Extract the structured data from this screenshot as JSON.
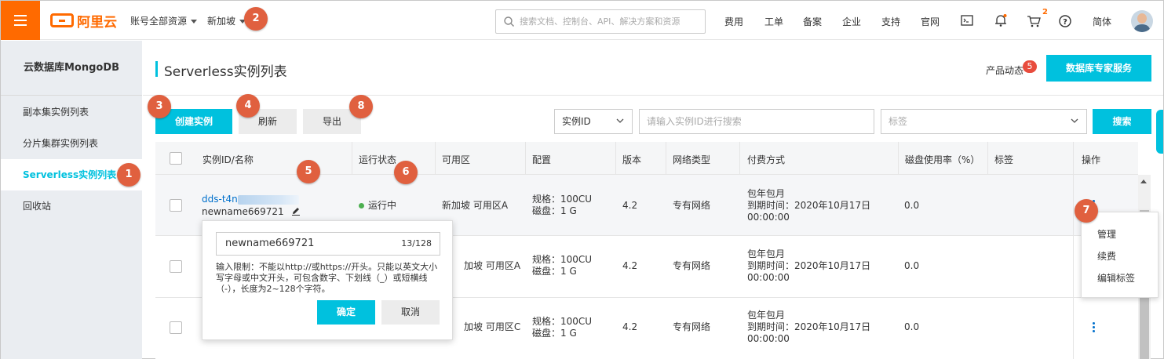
{
  "topbar": {
    "brand": "阿里云",
    "account_scope": "账号全部资源",
    "region": "新加坡",
    "search_placeholder": "搜索文档、控制台、API、解决方案和资源",
    "nav": [
      "费用",
      "工单",
      "备案",
      "企业",
      "支持",
      "官网"
    ],
    "cart_count": "2",
    "language": "简体"
  },
  "sidebar": {
    "title": "云数据库MongoDB",
    "items": [
      "副本集实例列表",
      "分片集群实例列表",
      "Serverless实例列表",
      "回收站"
    ],
    "active_index": 2
  },
  "header": {
    "title": "Serverless实例列表",
    "news_label": "产品动态",
    "news_count": "5",
    "expert_button": "数据库专家服务"
  },
  "toolbar": {
    "create_label": "创建实例",
    "refresh_label": "刷新",
    "export_label": "导出",
    "filter_field": "实例ID",
    "search_placeholder": "请输入实例ID进行搜索",
    "tag_placeholder": "标签",
    "search_label": "搜索"
  },
  "table": {
    "columns": [
      "实例ID/名称",
      "运行状态",
      "可用区",
      "配置",
      "版本",
      "网络类型",
      "付费方式",
      "磁盘使用率（%）",
      "标签",
      "操作"
    ],
    "rows": [
      {
        "id": "dds-t4n",
        "name": "newname669721",
        "status": "运行中",
        "zone": "新加坡 可用区A",
        "spec": "规格：100CU",
        "disk": "磁盘：1 G",
        "version": "4.2",
        "network": "专有网络",
        "billing": "包年包月",
        "expire": "到期时间：2020年10月17日",
        "expire_time": "00:00:00",
        "usage": "0.0"
      },
      {
        "id": "",
        "name": "",
        "status": "",
        "zone": "加坡 可用区A",
        "spec": "规格：100CU",
        "disk": "磁盘：1 G",
        "version": "4.2",
        "network": "专有网络",
        "billing": "包年包月",
        "expire": "到期时间：2020年10月17日",
        "expire_time": "00:00:00",
        "usage": "0.0"
      },
      {
        "id": "",
        "name": "",
        "status": "",
        "zone": "加坡 可用区C",
        "spec": "规格：100CU",
        "disk": "磁盘：1 G",
        "version": "4.2",
        "network": "专有网络",
        "billing": "包年包月",
        "expire": "到期时间：2020年10月17日",
        "expire_time": "00:00:00",
        "usage": "0.0"
      }
    ]
  },
  "rename_popover": {
    "value": "newname669721",
    "counter": "13/128",
    "hint": "输入限制：不能以http://或https://开头。只能以英文大小写字母或中文开头，可包含数字、下划线（_）或短横线（-），长度为2~128个字符。",
    "confirm": "确定",
    "cancel": "取消"
  },
  "ops_menu": [
    "管理",
    "续费",
    "编辑标签"
  ],
  "markers": [
    "1",
    "2",
    "3",
    "4",
    "5",
    "6",
    "7",
    "8"
  ],
  "colors": {
    "brand_orange": "#ff6a00",
    "accent_cyan": "#00c1de",
    "link_blue": "#0070cc",
    "marker": "#e0603f",
    "status_green": "#4caf50"
  }
}
